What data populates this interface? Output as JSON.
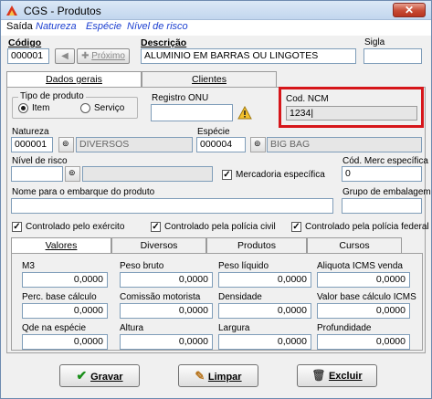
{
  "window": {
    "title": "CGS - Produtos",
    "close_glyph": "✕"
  },
  "menu": {
    "items": [
      "Saída",
      "Natureza",
      "Espécie",
      "Nível de risco"
    ]
  },
  "header": {
    "codigo_label": "Código",
    "codigo_value": "000001",
    "nav_prev_glyph": "◀",
    "nav_next_label": "Próximo",
    "descricao_label": "Descrição",
    "descricao_value": "ALUMINIO EM BARRAS OU LINGOTES",
    "sigla_label": "Sigla",
    "sigla_value": ""
  },
  "top_tabs": {
    "dados_gerais": "Dados gerais",
    "clientes": "Clientes"
  },
  "dados": {
    "tipo_produto_label": "Tipo de produto",
    "item_label": "Item",
    "servico_label": "Serviço",
    "registro_onu_label": "Registro ONU",
    "registro_onu_value": "",
    "cod_ncm_label": "Cod. NCM",
    "cod_ncm_value": "1234",
    "natureza_label": "Natureza",
    "natureza_code": "000001",
    "natureza_desc": "DIVERSOS",
    "especie_label": "Espécie",
    "especie_code": "000004",
    "especie_desc": "BIG BAG",
    "nivel_risco_label": "Nível de risco",
    "nivel_risco_code": "",
    "nivel_risco_desc": "",
    "mercadoria_especifica_label": "Mercadoria específica",
    "cod_merc_label": "Cód. Merc específica",
    "cod_merc_value": "0",
    "nome_embarque_label": "Nome para o embarque do produto",
    "nome_embarque_value": "",
    "grupo_embalagem_label": "Grupo de embalagem",
    "grupo_embalagem_value": "",
    "ctrl_exercito_label": "Controlado pelo exército",
    "ctrl_civil_label": "Controlado pela polícia civil",
    "ctrl_federal_label": "Controlado pela polícia federal",
    "check_glyph": "✓"
  },
  "inner_tabs": {
    "valores": "Valores",
    "diversos": "Diversos",
    "incompativeis": "Produtos incompatíveis",
    "cursos": "Cursos"
  },
  "valores": {
    "m3_label": "M3",
    "m3": "0,0000",
    "peso_bruto_label": "Peso bruto",
    "peso_bruto": "0,0000",
    "peso_liquido_label": "Peso líquido",
    "peso_liquido": "0,0000",
    "aliquota_label": "Aliquota ICMS venda",
    "aliquota": "0,0000",
    "perc_base_label": "Perc. base cálculo",
    "perc_base": "0,0000",
    "comissao_label": "Comissão motorista",
    "comissao": "0,0000",
    "densidade_label": "Densidade",
    "densidade": "0,0000",
    "valor_base_label": "Valor base cálculo ICMS",
    "valor_base": "0,0000",
    "qde_especie_label": "Qde na espécie",
    "qde_especie": "0,0000",
    "altura_label": "Altura",
    "altura": "0,0000",
    "largura_label": "Largura",
    "largura": "0,0000",
    "profundidade_label": "Profundidade",
    "profundidade": "0,0000"
  },
  "footer": {
    "gravar": "Gravar",
    "limpar": "Limpar",
    "excluir": "Excluir"
  },
  "colors": {
    "accent_red": "#d6161a",
    "menu_blue": "#1b3fd0",
    "gravar_check": "#1a8f1a"
  }
}
